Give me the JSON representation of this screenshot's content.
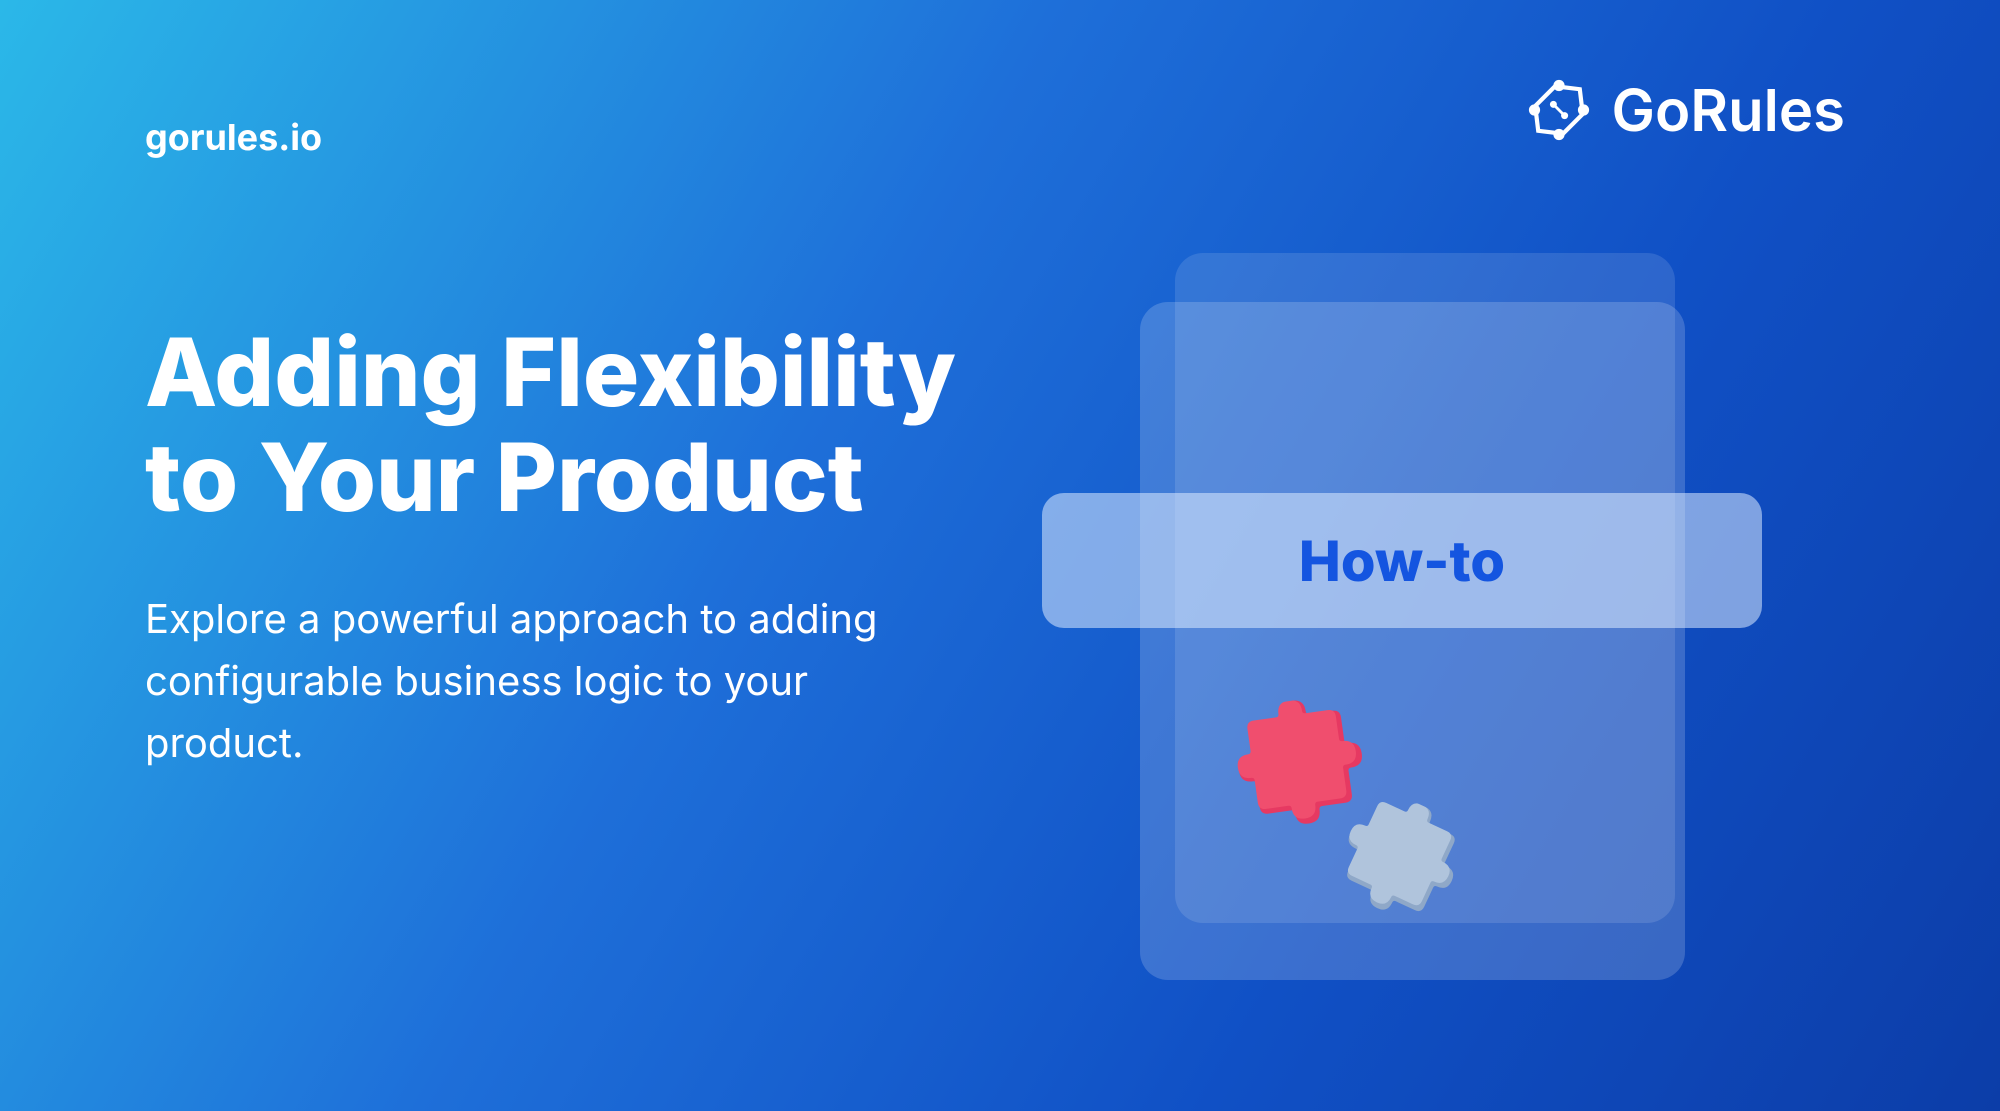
{
  "header": {
    "site_url": "gorules.io",
    "logo_text": "GoRules"
  },
  "main": {
    "title": "Adding Flexibility to Your Product",
    "subtitle": "Explore a powerful approach to adding configurable business logic to your product."
  },
  "badge": {
    "label": "How-to"
  }
}
